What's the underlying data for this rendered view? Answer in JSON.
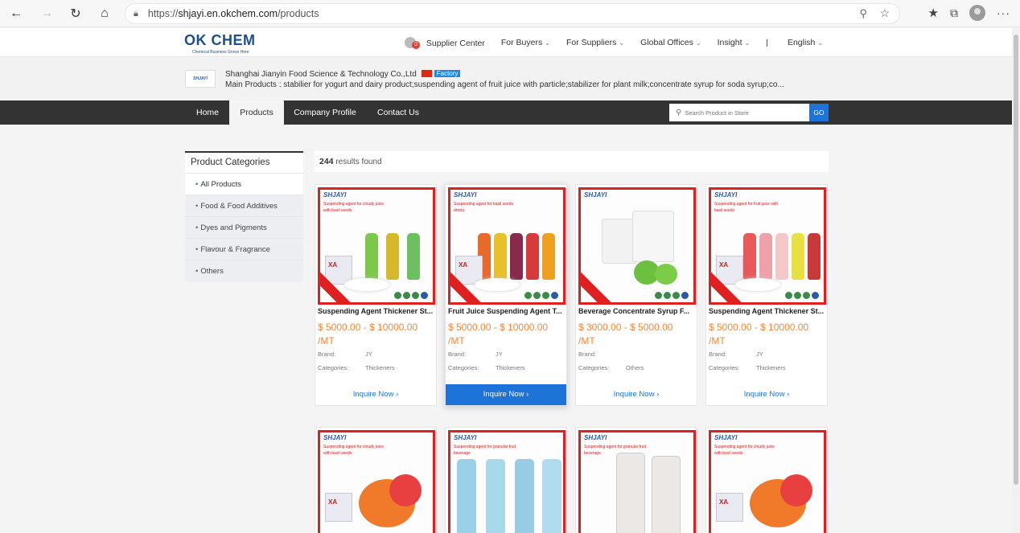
{
  "browser": {
    "url_prefix": "https://",
    "url_host": "shjayi.en.okchem.com",
    "url_path": "/products"
  },
  "site": {
    "logo": "OK CHEM",
    "logo_tagline": "Chemical Business Grows Here",
    "menu": [
      {
        "label": "Supplier Center",
        "badge": "0"
      },
      {
        "label": "For Buyers"
      },
      {
        "label": "For Suppliers"
      },
      {
        "label": "Global Offices"
      },
      {
        "label": "Insight"
      },
      {
        "label": "|"
      },
      {
        "label": "English"
      }
    ]
  },
  "company": {
    "logo": "SHJAYI",
    "name": "Shanghai Jianyin Food Science & Technology Co.,Ltd",
    "badge": "Factory",
    "main_products_label": "Main Products :",
    "main_products": "stabilier for yogurt and dairy product;suspending agent of fruit juice with particle;stabilizer for plant milk;concentrate syrup for soda syrup;co..."
  },
  "store_nav": {
    "tabs": [
      "Home",
      "Products",
      "Company Profile",
      "Contact Us"
    ],
    "active": "Products",
    "search_placeholder": "Search Product in Store",
    "go": "GO"
  },
  "sidebar": {
    "title": "Product Categories",
    "items": [
      "All Products",
      "Food & Food Additives",
      "Dyes and Pigments",
      "Flavour & Fragrance",
      "Others"
    ]
  },
  "results": {
    "count": "244",
    "label": "results found"
  },
  "products": [
    {
      "name": "Suspending Agent Thickener St...",
      "price_range": "$ 5000.00 - $ 10000.00",
      "unit": "/MT",
      "brand_label": "Brand:",
      "brand": "JY",
      "cat_label": "Categories:",
      "category": "Thickeners",
      "img_brand": "SHJAYI",
      "img_text": "Suspending agent for cloudy juice with basil seeds",
      "inquire": "Inquire Now ›"
    },
    {
      "name": "Fruit Juice Suspending Agent T...",
      "price_range": "$ 5000.00 - $ 10000.00",
      "unit": "/MT",
      "brand_label": "Brand:",
      "brand": "JY",
      "cat_label": "Categories:",
      "category": "Thickeners",
      "img_brand": "SHJAYI",
      "img_text": "Suspending agent for basil seeds drinks",
      "inquire": "Inquire Now ›"
    },
    {
      "name": "Beverage Concentrate Syrup F...",
      "price_range": "$ 3000.00 - $ 5000.00",
      "unit": "/MT",
      "brand_label": "Brand:",
      "brand": "",
      "cat_label": "Categories:",
      "category": "Others",
      "img_brand": "SHJAYI",
      "img_text": "",
      "inquire": "Inquire Now ›"
    },
    {
      "name": "Suspending Agent Thickener St...",
      "price_range": "$ 5000.00 - $ 10000.00",
      "unit": "/MT",
      "brand_label": "Brand:",
      "brand": "JY",
      "cat_label": "Categories:",
      "category": "Thickeners",
      "img_brand": "SHJAYI",
      "img_text": "Suspending agent for fruit juice with basil seeds",
      "inquire": "Inquire Now ›"
    }
  ],
  "products_row2": [
    {
      "img_brand": "SHJAYI",
      "img_text": "Suspending agent for cloudy juice with basil seeds"
    },
    {
      "img_brand": "SHJAYI",
      "img_text": "Suspending agent for granular fruit beverage"
    },
    {
      "img_brand": "SHJAYI",
      "img_text": "Suspending agent for granular fruit beverage"
    },
    {
      "img_brand": "SHJAYI",
      "img_text": "Suspending agent for cloudy juice with basil seeds"
    }
  ],
  "colors": {
    "accent": "#1e73d8",
    "price": "#f08a3c",
    "nav_bg": "#333333",
    "img_border": "#e02020"
  }
}
